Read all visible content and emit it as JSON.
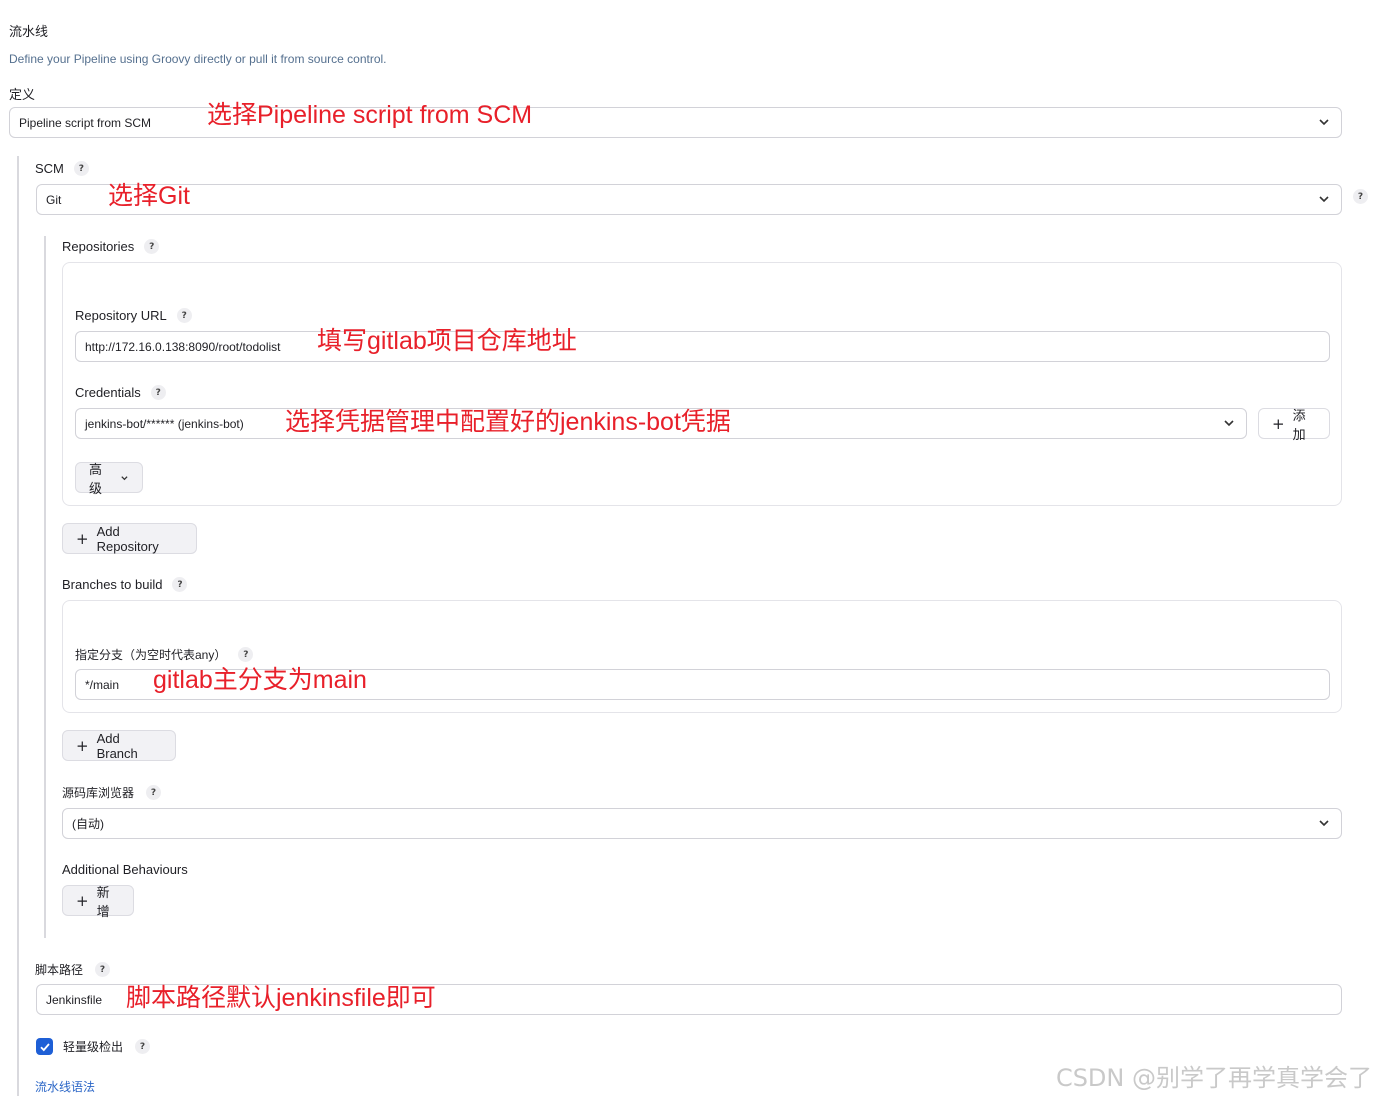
{
  "section": {
    "title": "流水线",
    "description": "Define your Pipeline using Groovy directly or pull it from source control."
  },
  "definition": {
    "label": "定义",
    "value": "Pipeline script from SCM",
    "annotation": "选择Pipeline script from SCM"
  },
  "scm": {
    "label": "SCM",
    "value": "Git",
    "annotation": "选择Git"
  },
  "repositories": {
    "label": "Repositories",
    "url_label": "Repository URL",
    "url_value": "http://172.16.0.138:8090/root/todolist",
    "url_annotation": "填写gitlab项目仓库地址",
    "credentials_label": "Credentials",
    "credentials_value": "jenkins-bot/****** (jenkins-bot)",
    "credentials_annotation": "选择凭据管理中配置好的jenkins-bot凭据",
    "add_credentials_label": "添加",
    "advanced_label": "高级",
    "add_repository_label": "Add Repository"
  },
  "branches": {
    "label": "Branches to build",
    "spec_label": "指定分支（为空时代表any）",
    "spec_value": "*/main",
    "spec_annotation": "gitlab主分支为main",
    "add_branch_label": "Add Branch"
  },
  "browser": {
    "label": "源码库浏览器",
    "value": "(自动)"
  },
  "behaviours": {
    "label": "Additional Behaviours",
    "add_label": "新增"
  },
  "script_path": {
    "label": "脚本路径",
    "value": "Jenkinsfile",
    "annotation": "脚本路径默认jenkinsfile即可"
  },
  "lightweight": {
    "label": "轻量级检出",
    "checked": true
  },
  "syntax_link": "流水线语法",
  "watermark": "CSDN @别学了再学真学会了",
  "help_glyph": "?",
  "colors": {
    "annotation": "#e8202a",
    "checkbox": "#1e5fd6",
    "link": "#2c67c7"
  }
}
